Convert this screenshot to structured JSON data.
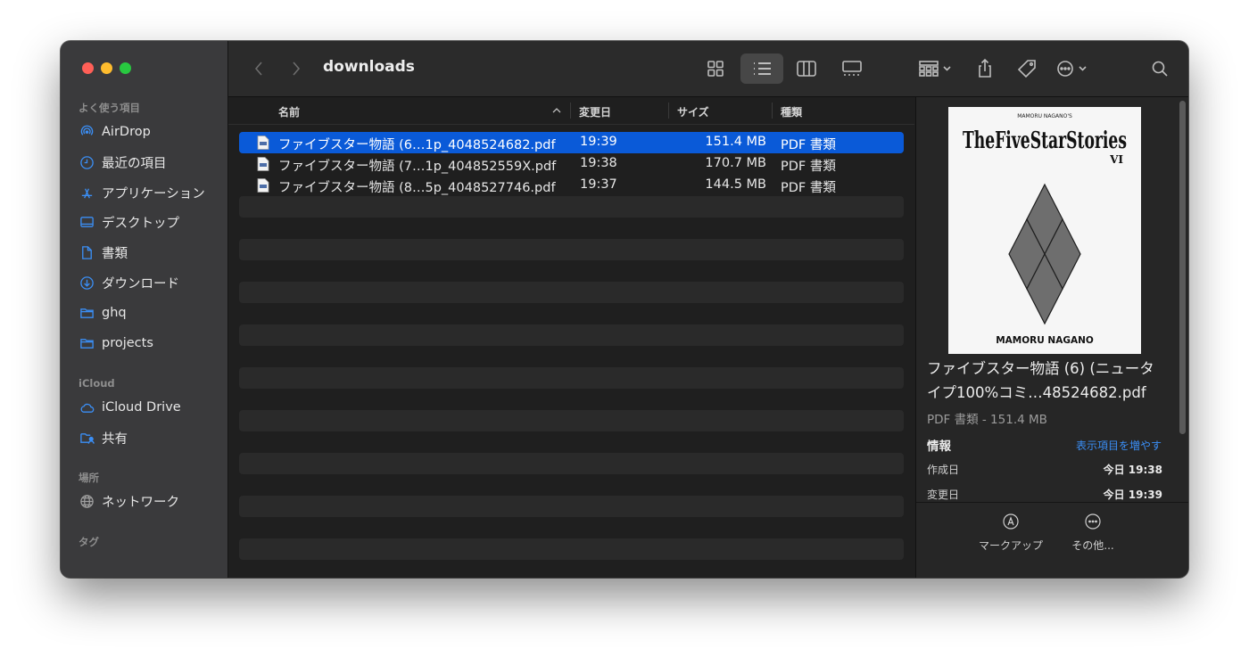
{
  "window": {
    "title": "downloads"
  },
  "sidebar": {
    "section_favorites": "よく使う項目",
    "favorites": [
      {
        "label": "AirDrop",
        "icon": "airdrop-icon"
      },
      {
        "label": "最近の項目",
        "icon": "recents-clock-icon"
      },
      {
        "label": "アプリケーション",
        "icon": "applications-icon"
      },
      {
        "label": "デスクトップ",
        "icon": "desktop-icon"
      },
      {
        "label": "書類",
        "icon": "document-icon"
      },
      {
        "label": "ダウンロード",
        "icon": "download-icon"
      },
      {
        "label": "ghq",
        "icon": "folder-icon"
      },
      {
        "label": "projects",
        "icon": "folder-icon"
      }
    ],
    "section_icloud": "iCloud",
    "icloud": [
      {
        "label": "iCloud Drive",
        "icon": "cloud-icon"
      },
      {
        "label": "共有",
        "icon": "shared-folder-icon"
      }
    ],
    "section_locations": "場所",
    "locations": [
      {
        "label": "ネットワーク",
        "icon": "network-globe-icon"
      }
    ],
    "section_tags": "タグ"
  },
  "list": {
    "headers": {
      "name": "名前",
      "date": "変更日",
      "size": "サイズ",
      "kind": "種類"
    },
    "files": [
      {
        "name": "ファイブスター物語 (6…1p_4048524682.pdf",
        "date": "19:39",
        "size": "151.4 MB",
        "kind": "PDF 書類"
      },
      {
        "name": "ファイブスター物語 (7…1p_404852559X.pdf",
        "date": "19:38",
        "size": "170.7 MB",
        "kind": "PDF 書類"
      },
      {
        "name": "ファイブスター物語 (8…5p_4048527746.pdf",
        "date": "19:37",
        "size": "144.5 MB",
        "kind": "PDF 書類"
      }
    ]
  },
  "preview": {
    "cover": {
      "subtitle": "MAMORU NAGANO'S",
      "title": "TheFiveStarStories",
      "volume": "VI",
      "author": "MAMORU NAGANO"
    },
    "file_name": "ファイブスター物語 (6) (ニュータイプ100%コミ…48524682.pdf",
    "kind_size": "PDF 書類 - 151.4 MB",
    "info_label": "情報",
    "more_label": "表示項目を増やす",
    "created_label": "作成日",
    "created_value": "今日 19:38",
    "modified_label": "変更日",
    "modified_value": "今日 19:39",
    "markup_label": "マークアップ",
    "other_label": "その他..."
  },
  "colors": {
    "selection": "#0a5ad8",
    "link": "#3a8ef6"
  }
}
